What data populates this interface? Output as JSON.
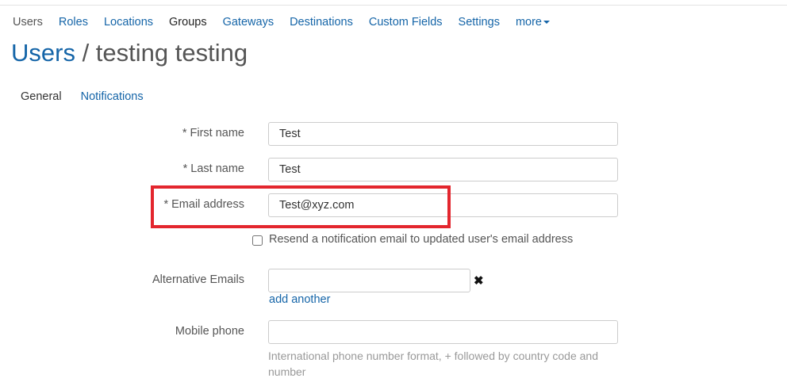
{
  "nav": {
    "items": [
      {
        "label": "Users",
        "name": "nav-users"
      },
      {
        "label": "Roles",
        "name": "nav-roles"
      },
      {
        "label": "Locations",
        "name": "nav-locations"
      },
      {
        "label": "Groups",
        "name": "nav-groups"
      },
      {
        "label": "Gateways",
        "name": "nav-gateways"
      },
      {
        "label": "Destinations",
        "name": "nav-destinations"
      },
      {
        "label": "Custom Fields",
        "name": "nav-custom-fields"
      },
      {
        "label": "Settings",
        "name": "nav-settings"
      }
    ],
    "more_label": "more"
  },
  "title": {
    "link": "Users",
    "separator": " / ",
    "name": "testing testing"
  },
  "tabs": {
    "general": "General",
    "notifications": "Notifications"
  },
  "form": {
    "first_name": {
      "label": "* First name",
      "value": "Test"
    },
    "last_name": {
      "label": "* Last name",
      "value": "Test"
    },
    "email": {
      "label": "* Email address",
      "value": "Test@xyz.com"
    },
    "resend_checkbox": {
      "label": "Resend a notification email to updated user's email address",
      "checked": false
    },
    "alt_emails": {
      "label": "Alternative Emails",
      "value": "",
      "remove_symbol": "✖",
      "add_another": "add another"
    },
    "mobile_phone": {
      "label": "Mobile phone",
      "value": "",
      "help": "International phone number format, + followed by country code and number"
    }
  },
  "colors": {
    "link": "#1565a8",
    "highlight": "#e3262e"
  }
}
